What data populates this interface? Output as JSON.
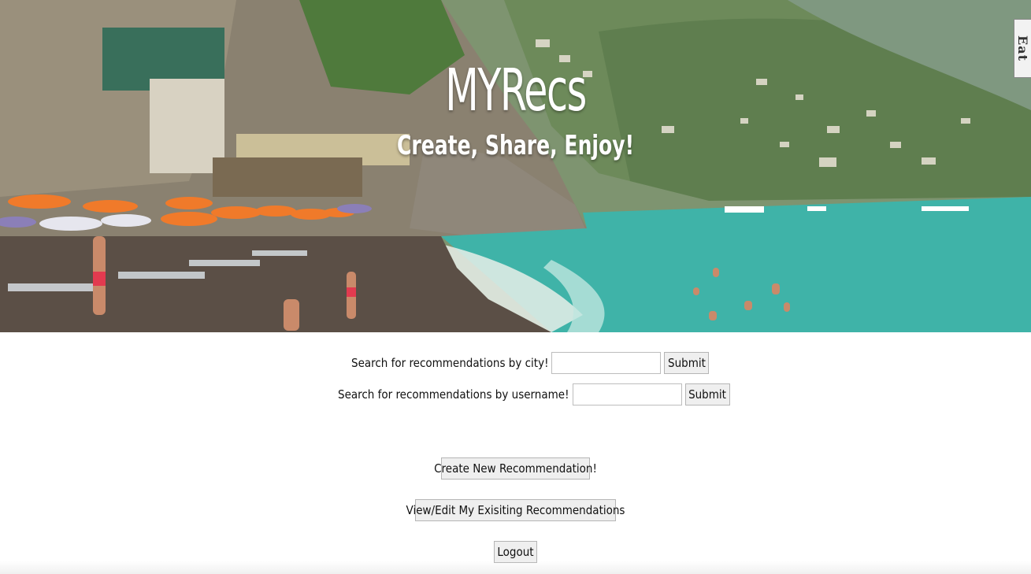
{
  "hero": {
    "title": "MYRecs",
    "subtitle": "Create, Share, Enjoy!",
    "corner_tab": "Eat",
    "image_description_icon": "beach-photo"
  },
  "search": {
    "city": {
      "label": "Search for recommendations by city!",
      "value": "",
      "placeholder": "",
      "submit": "Submit"
    },
    "username": {
      "label": "Search for recommendations by username!",
      "value": "",
      "placeholder": "",
      "submit": "Submit"
    }
  },
  "actions": {
    "create": "Create New Recommendation!",
    "view_edit": "View/Edit My Exisiting Recommendations",
    "logout": "Logout"
  },
  "colors": {
    "sea": "#3fb3a8",
    "umbrella": "#f07a2a",
    "sand": "#5b4f46",
    "button_bg": "#efefef",
    "text": "#111111"
  }
}
